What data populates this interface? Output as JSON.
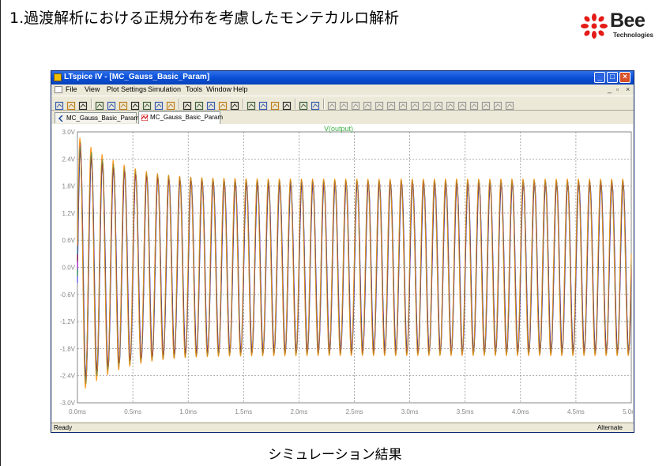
{
  "slide": {
    "title": "1.過渡解析における正規分布を考慮したモンテカルロ解析",
    "caption": "シミュレーション結果",
    "logo": {
      "name": "Bee",
      "sub": "Technologies",
      "icon": "bee-logo-icon",
      "accent": "#e41b17"
    }
  },
  "window": {
    "title": "LTspice IV - [MC_Gauss_Basic_Param]",
    "menu": [
      "File",
      "View",
      "Plot Settings",
      "Simulation",
      "Tools",
      "Window",
      "Help"
    ],
    "tabs": [
      {
        "label": "MC_Gauss_Basic_Param",
        "icon": "schematic-icon",
        "active": false
      },
      {
        "label": "MC_Gauss_Basic_Param",
        "icon": "waveform-icon",
        "active": true
      }
    ],
    "status_left": "Ready",
    "status_right": "Alternate",
    "titlebar_color": "#0a4fd8"
  },
  "chart_data": {
    "type": "line",
    "title": "V(output)",
    "xlabel": "",
    "ylabel": "",
    "xlim": [
      0,
      5.0
    ],
    "ylim": [
      -3.0,
      3.0
    ],
    "x_ticks": [
      "0.0ms",
      "0.5ms",
      "1.0ms",
      "1.5ms",
      "2.0ms",
      "2.5ms",
      "3.0ms",
      "3.5ms",
      "4.0ms",
      "4.5ms",
      "5.0ms"
    ],
    "y_ticks": [
      "3.0V",
      "2.4V",
      "1.8V",
      "1.2V",
      "0.6V",
      "0.0V",
      "-0.6V",
      "-1.2V",
      "-1.8V",
      "-2.4V",
      "-3.0V"
    ],
    "grid": true,
    "signal": {
      "frequency_khz": 10,
      "steady_amplitude_v": 1.9,
      "initial_peak_v": 2.85,
      "initial_trough_v": -2.65,
      "settling_time_ms": 1.0,
      "run_count": 6
    },
    "series_colors": [
      "#1a1aff",
      "#008000",
      "#ff00ff",
      "#800000",
      "#00a0a0",
      "#ff8c00"
    ]
  }
}
